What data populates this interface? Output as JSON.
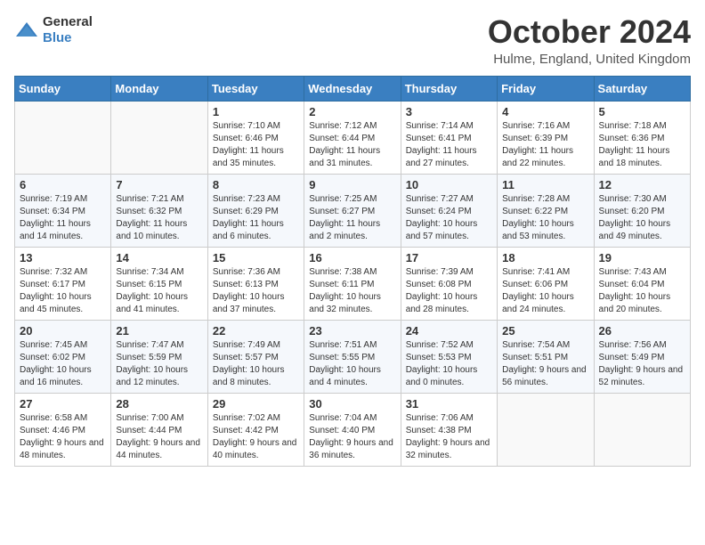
{
  "header": {
    "logo_general": "General",
    "logo_blue": "Blue",
    "title": "October 2024",
    "location": "Hulme, England, United Kingdom"
  },
  "weekdays": [
    "Sunday",
    "Monday",
    "Tuesday",
    "Wednesday",
    "Thursday",
    "Friday",
    "Saturday"
  ],
  "weeks": [
    [
      {
        "day": "",
        "info": ""
      },
      {
        "day": "",
        "info": ""
      },
      {
        "day": "1",
        "info": "Sunrise: 7:10 AM\nSunset: 6:46 PM\nDaylight: 11 hours and 35 minutes."
      },
      {
        "day": "2",
        "info": "Sunrise: 7:12 AM\nSunset: 6:44 PM\nDaylight: 11 hours and 31 minutes."
      },
      {
        "day": "3",
        "info": "Sunrise: 7:14 AM\nSunset: 6:41 PM\nDaylight: 11 hours and 27 minutes."
      },
      {
        "day": "4",
        "info": "Sunrise: 7:16 AM\nSunset: 6:39 PM\nDaylight: 11 hours and 22 minutes."
      },
      {
        "day": "5",
        "info": "Sunrise: 7:18 AM\nSunset: 6:36 PM\nDaylight: 11 hours and 18 minutes."
      }
    ],
    [
      {
        "day": "6",
        "info": "Sunrise: 7:19 AM\nSunset: 6:34 PM\nDaylight: 11 hours and 14 minutes."
      },
      {
        "day": "7",
        "info": "Sunrise: 7:21 AM\nSunset: 6:32 PM\nDaylight: 11 hours and 10 minutes."
      },
      {
        "day": "8",
        "info": "Sunrise: 7:23 AM\nSunset: 6:29 PM\nDaylight: 11 hours and 6 minutes."
      },
      {
        "day": "9",
        "info": "Sunrise: 7:25 AM\nSunset: 6:27 PM\nDaylight: 11 hours and 2 minutes."
      },
      {
        "day": "10",
        "info": "Sunrise: 7:27 AM\nSunset: 6:24 PM\nDaylight: 10 hours and 57 minutes."
      },
      {
        "day": "11",
        "info": "Sunrise: 7:28 AM\nSunset: 6:22 PM\nDaylight: 10 hours and 53 minutes."
      },
      {
        "day": "12",
        "info": "Sunrise: 7:30 AM\nSunset: 6:20 PM\nDaylight: 10 hours and 49 minutes."
      }
    ],
    [
      {
        "day": "13",
        "info": "Sunrise: 7:32 AM\nSunset: 6:17 PM\nDaylight: 10 hours and 45 minutes."
      },
      {
        "day": "14",
        "info": "Sunrise: 7:34 AM\nSunset: 6:15 PM\nDaylight: 10 hours and 41 minutes."
      },
      {
        "day": "15",
        "info": "Sunrise: 7:36 AM\nSunset: 6:13 PM\nDaylight: 10 hours and 37 minutes."
      },
      {
        "day": "16",
        "info": "Sunrise: 7:38 AM\nSunset: 6:11 PM\nDaylight: 10 hours and 32 minutes."
      },
      {
        "day": "17",
        "info": "Sunrise: 7:39 AM\nSunset: 6:08 PM\nDaylight: 10 hours and 28 minutes."
      },
      {
        "day": "18",
        "info": "Sunrise: 7:41 AM\nSunset: 6:06 PM\nDaylight: 10 hours and 24 minutes."
      },
      {
        "day": "19",
        "info": "Sunrise: 7:43 AM\nSunset: 6:04 PM\nDaylight: 10 hours and 20 minutes."
      }
    ],
    [
      {
        "day": "20",
        "info": "Sunrise: 7:45 AM\nSunset: 6:02 PM\nDaylight: 10 hours and 16 minutes."
      },
      {
        "day": "21",
        "info": "Sunrise: 7:47 AM\nSunset: 5:59 PM\nDaylight: 10 hours and 12 minutes."
      },
      {
        "day": "22",
        "info": "Sunrise: 7:49 AM\nSunset: 5:57 PM\nDaylight: 10 hours and 8 minutes."
      },
      {
        "day": "23",
        "info": "Sunrise: 7:51 AM\nSunset: 5:55 PM\nDaylight: 10 hours and 4 minutes."
      },
      {
        "day": "24",
        "info": "Sunrise: 7:52 AM\nSunset: 5:53 PM\nDaylight: 10 hours and 0 minutes."
      },
      {
        "day": "25",
        "info": "Sunrise: 7:54 AM\nSunset: 5:51 PM\nDaylight: 9 hours and 56 minutes."
      },
      {
        "day": "26",
        "info": "Sunrise: 7:56 AM\nSunset: 5:49 PM\nDaylight: 9 hours and 52 minutes."
      }
    ],
    [
      {
        "day": "27",
        "info": "Sunrise: 6:58 AM\nSunset: 4:46 PM\nDaylight: 9 hours and 48 minutes."
      },
      {
        "day": "28",
        "info": "Sunrise: 7:00 AM\nSunset: 4:44 PM\nDaylight: 9 hours and 44 minutes."
      },
      {
        "day": "29",
        "info": "Sunrise: 7:02 AM\nSunset: 4:42 PM\nDaylight: 9 hours and 40 minutes."
      },
      {
        "day": "30",
        "info": "Sunrise: 7:04 AM\nSunset: 4:40 PM\nDaylight: 9 hours and 36 minutes."
      },
      {
        "day": "31",
        "info": "Sunrise: 7:06 AM\nSunset: 4:38 PM\nDaylight: 9 hours and 32 minutes."
      },
      {
        "day": "",
        "info": ""
      },
      {
        "day": "",
        "info": ""
      }
    ]
  ]
}
